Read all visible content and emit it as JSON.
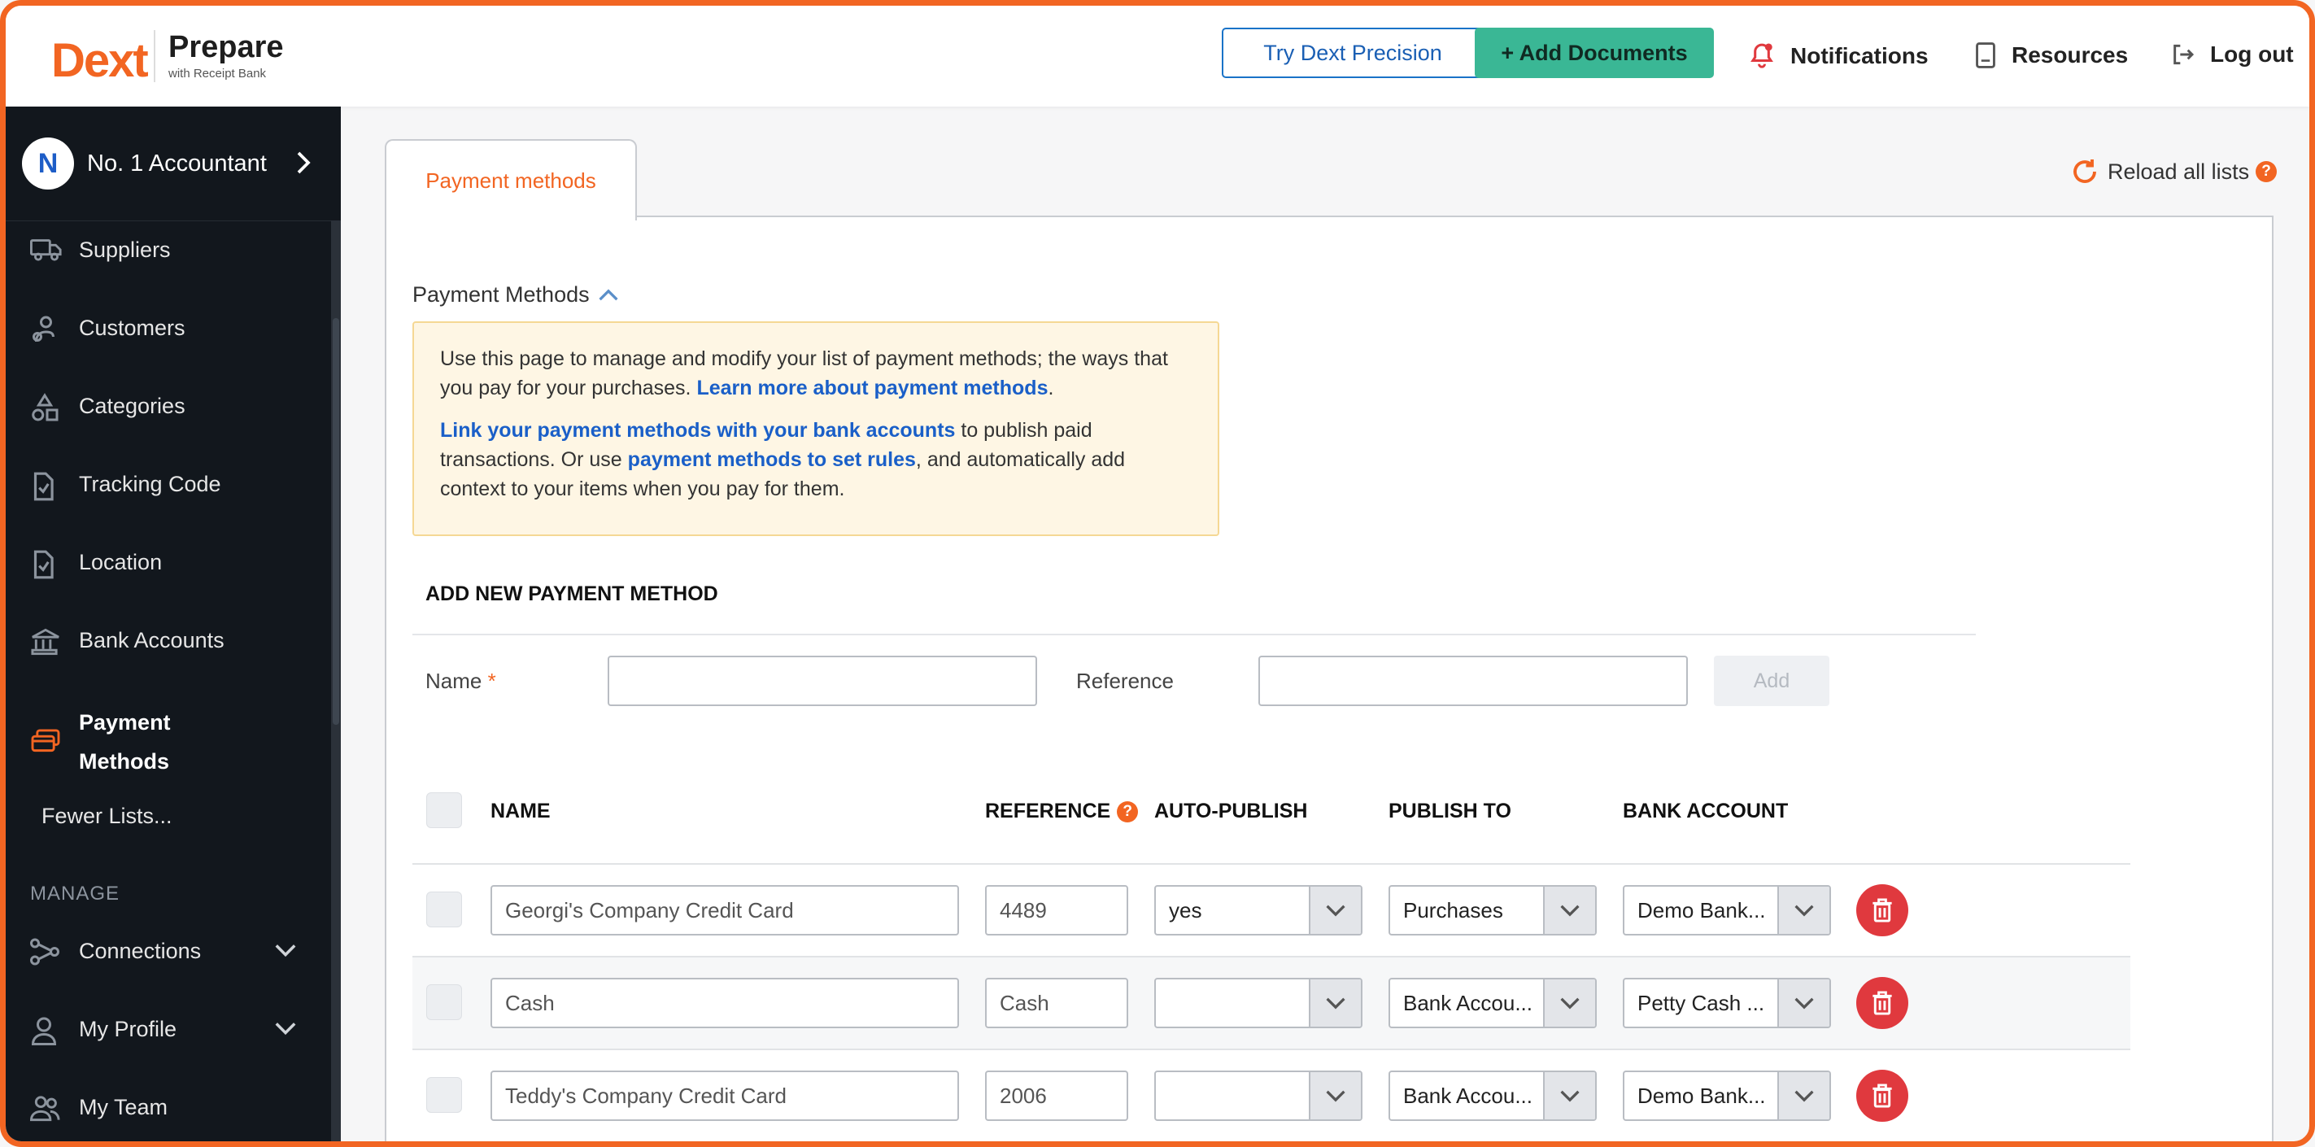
{
  "brand": {
    "logo": "Dext",
    "product": "Prepare",
    "tagline": "with Receipt Bank",
    "accent_color": "#f26522"
  },
  "header": {
    "try_precision": "Try Dext Precision",
    "add_documents": "+ Add Documents",
    "notifications": "Notifications",
    "resources": "Resources",
    "logout": "Log out"
  },
  "sidebar": {
    "account": {
      "initial": "N",
      "name": "No. 1 Accountant"
    },
    "items": [
      {
        "label": "Suppliers",
        "icon": "truck-icon"
      },
      {
        "label": "Customers",
        "icon": "customer-icon"
      },
      {
        "label": "Categories",
        "icon": "shapes-icon"
      },
      {
        "label": "Tracking Code",
        "icon": "clipboard-check-icon"
      },
      {
        "label": "Location",
        "icon": "clipboard-check-icon"
      },
      {
        "label": "Bank Accounts",
        "icon": "bank-icon"
      },
      {
        "label": "Payment Methods",
        "icon": "cards-icon",
        "active": true
      }
    ],
    "fewer_lists": "Fewer Lists...",
    "manage_heading": "MANAGE",
    "manage_items": [
      {
        "label": "Connections",
        "icon": "connections-icon"
      },
      {
        "label": "My Profile",
        "icon": "person-icon"
      },
      {
        "label": "My Team",
        "icon": "team-icon"
      }
    ]
  },
  "tab": {
    "label": "Payment methods"
  },
  "reload": {
    "label": "Reload all lists"
  },
  "section": {
    "title": "Payment Methods",
    "info": {
      "p1_text": "Use this page to manage and modify your list of payment methods; the ways that you pay for your purchases.",
      "p1_link": "Learn more about payment methods",
      "p1_end": ".",
      "p2_link1": "Link your payment methods with your bank accounts",
      "p2_mid": "to publish paid transactions. Or use",
      "p2_link2": "payment methods to set rules",
      "p2_end": ", and automatically add context to your items when you pay for them."
    }
  },
  "add_form": {
    "title": "ADD NEW PAYMENT METHOD",
    "name_label": "Name",
    "required_mark": "*",
    "reference_label": "Reference",
    "name_value": "",
    "reference_value": "",
    "add_button": "Add"
  },
  "table": {
    "headers": {
      "name": "NAME",
      "reference": "REFERENCE",
      "auto_publish": "AUTO-PUBLISH",
      "publish_to": "PUBLISH TO",
      "bank_account": "BANK ACCOUNT"
    },
    "rows": [
      {
        "name": "Georgi's Company Credit Card",
        "reference": "4489",
        "auto_publish": "yes",
        "publish_to": "Purchases",
        "bank_account": "Demo Bank..."
      },
      {
        "name": "Cash",
        "reference": "Cash",
        "auto_publish": "",
        "publish_to": "Bank Accou...",
        "bank_account": "Petty Cash ..."
      },
      {
        "name": "Teddy's Company Credit Card",
        "reference": "2006",
        "auto_publish": "",
        "publish_to": "Bank Accou...",
        "bank_account": "Demo Bank..."
      }
    ]
  }
}
